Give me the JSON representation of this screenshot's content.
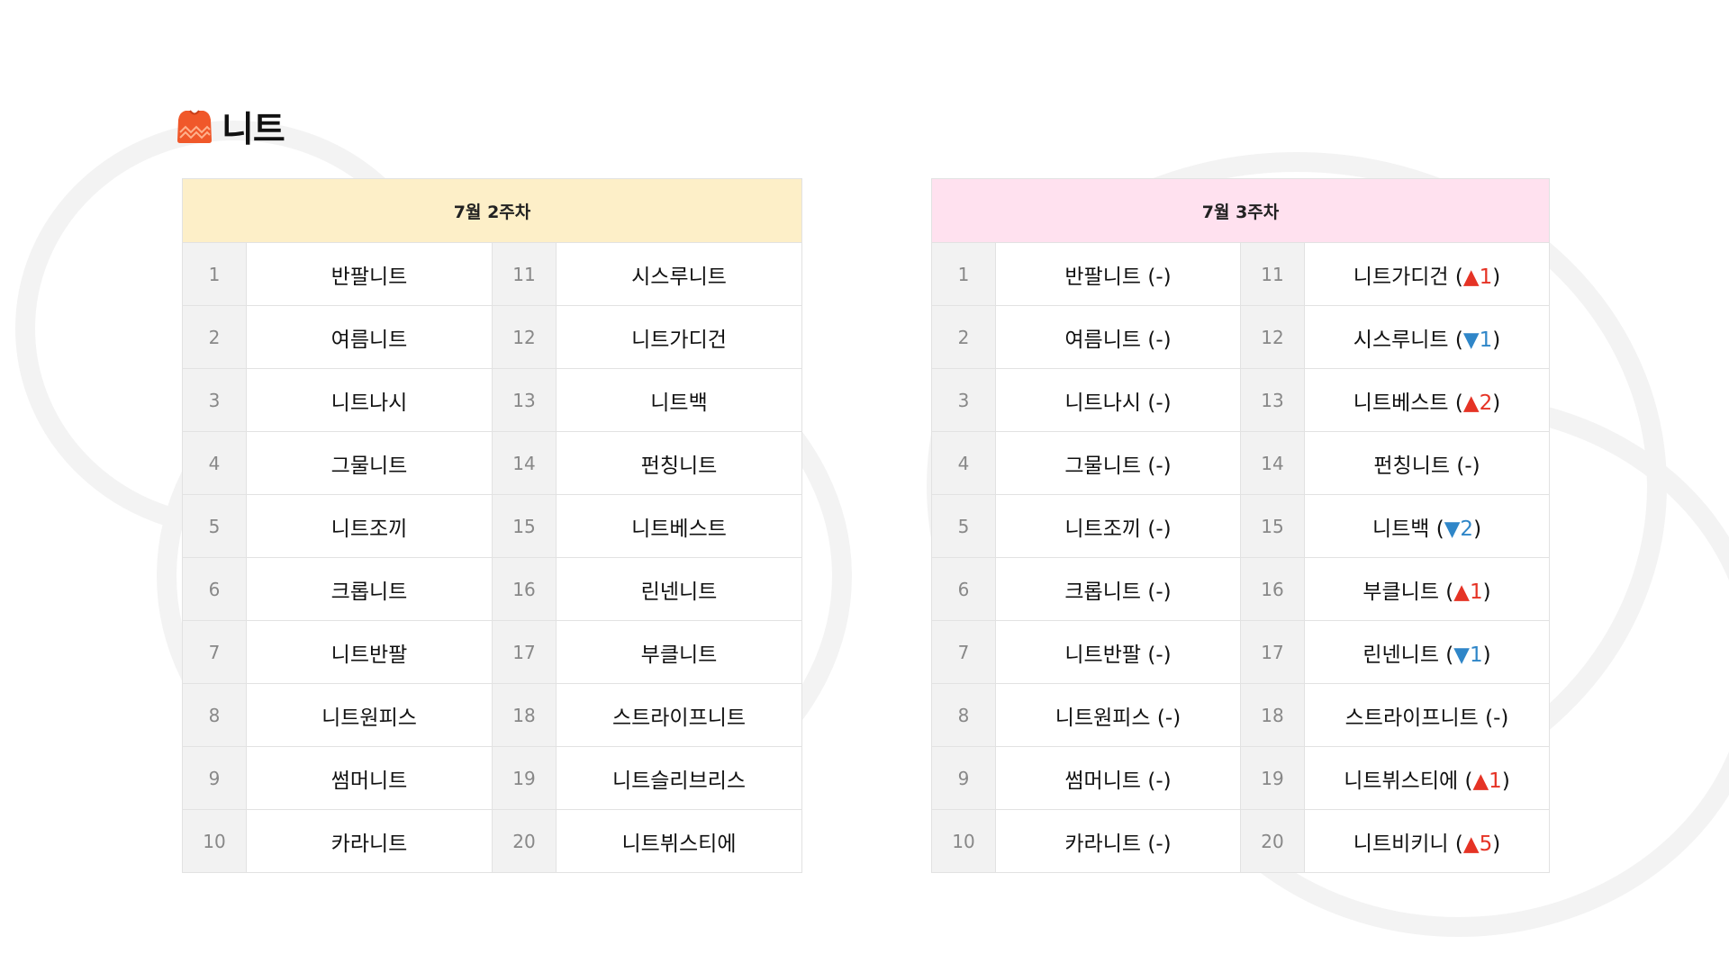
{
  "title": "니트",
  "colors": {
    "accent_orange": "#f0582a",
    "week2_header_bg": "#fdefc8",
    "week3_header_bg": "#ffe1ef",
    "rank_cell_bg": "#f2f2f2",
    "up": "#e53325",
    "down": "#2f86c8"
  },
  "icons": {
    "title_icon": "sweater-icon",
    "up": "▲",
    "down": "▼"
  },
  "week2": {
    "header": "7월 2주차",
    "rows": [
      {
        "rank_left": "1",
        "item_left": "반팔니트",
        "rank_right": "11",
        "item_right": "시스루니트"
      },
      {
        "rank_left": "2",
        "item_left": "여름니트",
        "rank_right": "12",
        "item_right": "니트가디건"
      },
      {
        "rank_left": "3",
        "item_left": "니트나시",
        "rank_right": "13",
        "item_right": "니트백"
      },
      {
        "rank_left": "4",
        "item_left": "그물니트",
        "rank_right": "14",
        "item_right": "펀칭니트"
      },
      {
        "rank_left": "5",
        "item_left": "니트조끼",
        "rank_right": "15",
        "item_right": "니트베스트"
      },
      {
        "rank_left": "6",
        "item_left": "크롭니트",
        "rank_right": "16",
        "item_right": "린넨니트"
      },
      {
        "rank_left": "7",
        "item_left": "니트반팔",
        "rank_right": "17",
        "item_right": "부클니트"
      },
      {
        "rank_left": "8",
        "item_left": "니트원피스",
        "rank_right": "18",
        "item_right": "스트라이프니트"
      },
      {
        "rank_left": "9",
        "item_left": "썸머니트",
        "rank_right": "19",
        "item_right": "니트슬리브리스"
      },
      {
        "rank_left": "10",
        "item_left": "카라니트",
        "rank_right": "20",
        "item_right": "니트뷔스티에"
      }
    ]
  },
  "week3": {
    "header": "7월 3주차",
    "rows": [
      {
        "rank_left": "1",
        "item_left": "반팔니트",
        "change_left": {
          "dir": "none",
          "value": "-"
        },
        "rank_right": "11",
        "item_right": "니트가디건",
        "change_right": {
          "dir": "up",
          "value": "1"
        }
      },
      {
        "rank_left": "2",
        "item_left": "여름니트",
        "change_left": {
          "dir": "none",
          "value": "-"
        },
        "rank_right": "12",
        "item_right": "시스루니트",
        "change_right": {
          "dir": "down",
          "value": "1"
        }
      },
      {
        "rank_left": "3",
        "item_left": "니트나시",
        "change_left": {
          "dir": "none",
          "value": "-"
        },
        "rank_right": "13",
        "item_right": "니트베스트",
        "change_right": {
          "dir": "up",
          "value": "2"
        }
      },
      {
        "rank_left": "4",
        "item_left": "그물니트",
        "change_left": {
          "dir": "none",
          "value": "-"
        },
        "rank_right": "14",
        "item_right": "펀칭니트",
        "change_right": {
          "dir": "none",
          "value": "-"
        }
      },
      {
        "rank_left": "5",
        "item_left": "니트조끼",
        "change_left": {
          "dir": "none",
          "value": "-"
        },
        "rank_right": "15",
        "item_right": "니트백",
        "change_right": {
          "dir": "down",
          "value": "2"
        }
      },
      {
        "rank_left": "6",
        "item_left": "크롭니트",
        "change_left": {
          "dir": "none",
          "value": "-"
        },
        "rank_right": "16",
        "item_right": "부클니트",
        "change_right": {
          "dir": "up",
          "value": "1"
        }
      },
      {
        "rank_left": "7",
        "item_left": "니트반팔",
        "change_left": {
          "dir": "none",
          "value": "-"
        },
        "rank_right": "17",
        "item_right": "린넨니트",
        "change_right": {
          "dir": "down",
          "value": "1"
        }
      },
      {
        "rank_left": "8",
        "item_left": "니트원피스",
        "change_left": {
          "dir": "none",
          "value": "-"
        },
        "rank_right": "18",
        "item_right": "스트라이프니트",
        "change_right": {
          "dir": "none",
          "value": "-"
        }
      },
      {
        "rank_left": "9",
        "item_left": "썸머니트",
        "change_left": {
          "dir": "none",
          "value": "-"
        },
        "rank_right": "19",
        "item_right": "니트뷔스티에",
        "change_right": {
          "dir": "up",
          "value": "1"
        }
      },
      {
        "rank_left": "10",
        "item_left": "카라니트",
        "change_left": {
          "dir": "none",
          "value": "-"
        },
        "rank_right": "20",
        "item_right": "니트비키니",
        "change_right": {
          "dir": "up",
          "value": "5"
        }
      }
    ]
  }
}
